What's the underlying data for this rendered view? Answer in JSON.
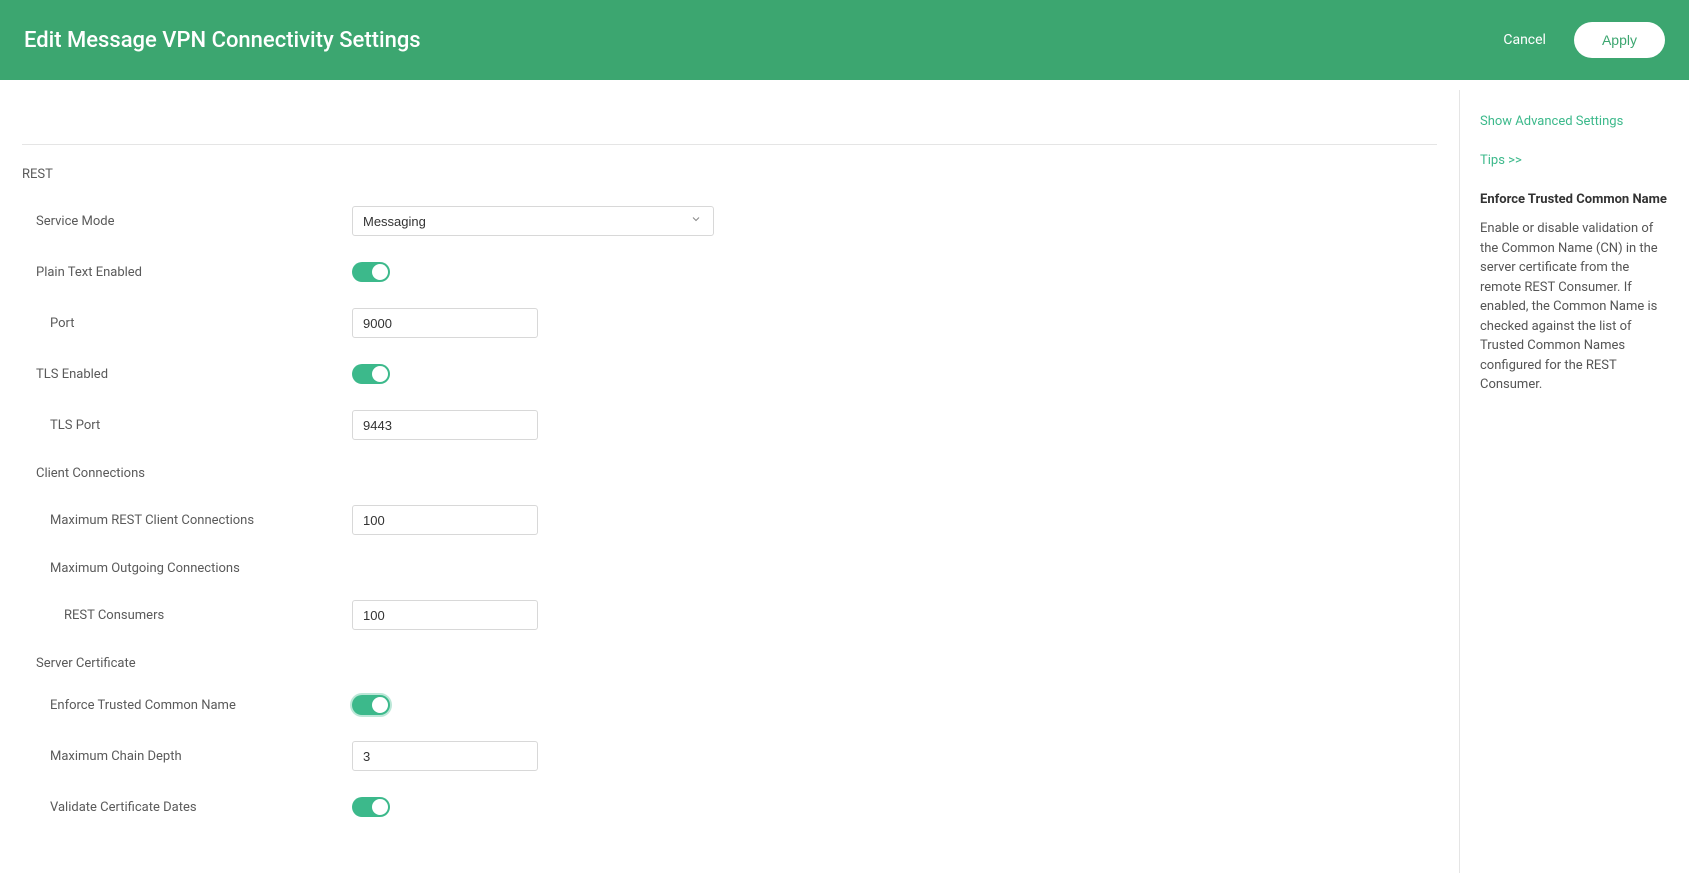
{
  "header": {
    "title": "Edit Message VPN Connectivity Settings",
    "cancel_label": "Cancel",
    "apply_label": "Apply"
  },
  "sidebar": {
    "show_advanced": "Show Advanced Settings",
    "tips": "Tips >>",
    "help_title": "Enforce Trusted Common Name",
    "help_body": "Enable or disable validation of the Common Name (CN) in the server certificate from the remote REST Consumer. If enabled, the Common Name is checked against the list of Trusted Common Names configured for the REST Consumer."
  },
  "section": {
    "rest": "REST",
    "service_mode_label": "Service Mode",
    "service_mode_value": "Messaging",
    "plain_text_enabled_label": "Plain Text Enabled",
    "port_label": "Port",
    "port_value": "9000",
    "tls_enabled_label": "TLS Enabled",
    "tls_port_label": "TLS Port",
    "tls_port_value": "9443",
    "client_connections_label": "Client Connections",
    "max_rest_client_label": "Maximum REST Client Connections",
    "max_rest_client_value": "100",
    "max_outgoing_label": "Maximum Outgoing Connections",
    "rest_consumers_label": "REST Consumers",
    "rest_consumers_value": "100",
    "server_cert_label": "Server Certificate",
    "enforce_cn_label": "Enforce Trusted Common Name",
    "max_chain_depth_label": "Maximum Chain Depth",
    "max_chain_depth_value": "3",
    "validate_cert_dates_label": "Validate Certificate Dates"
  }
}
